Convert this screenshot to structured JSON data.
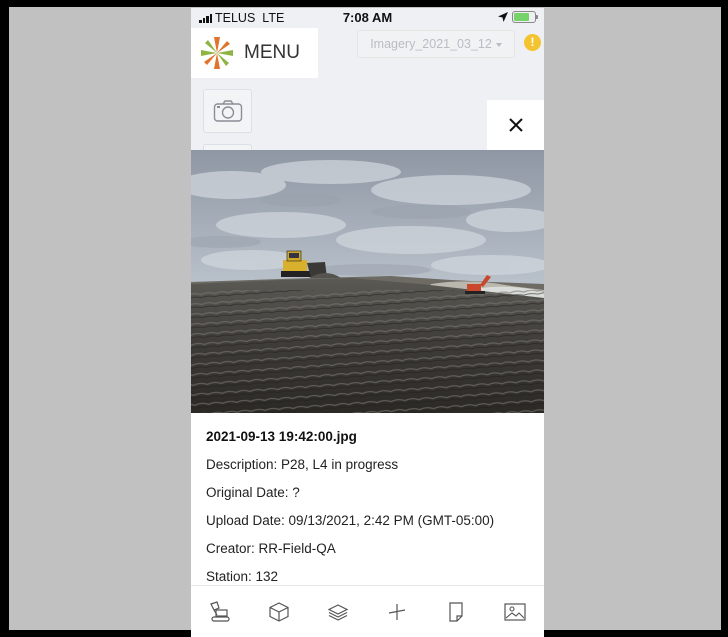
{
  "status_bar": {
    "carrier": "TELUS",
    "network": "LTE",
    "time": "7:08 AM"
  },
  "header": {
    "menu_label": "MENU",
    "imagery_select": "Imagery_2021_03_12",
    "alert_symbol": "!"
  },
  "popup": {
    "close_symbol": "×",
    "filename": "2021-09-13 19:42:00.jpg",
    "details": [
      "Description: P28, L4 in progress",
      "Original Date: ?",
      "Upload Date: 09/13/2021, 2:42 PM (GMT-05:00)",
      "Creator: RR-Field-QA",
      "Station: 132"
    ]
  },
  "toolbar": {
    "tools": [
      "excavator-icon",
      "cube-icon",
      "layers-icon",
      "measure-icon",
      "document-icon",
      "image-icon"
    ]
  },
  "colors": {
    "alert": "#f4c430",
    "battery": "#76d36a",
    "logo_orange": "#e0742c",
    "logo_green": "#8fb443"
  }
}
